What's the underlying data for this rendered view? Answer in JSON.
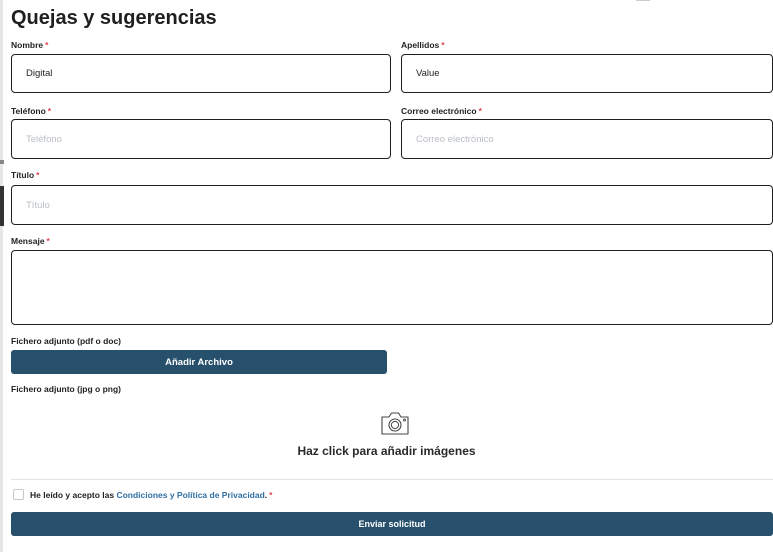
{
  "form": {
    "title": "Quejas y sugerencias",
    "required_mark": "*",
    "nombre": {
      "label": "Nombre",
      "value": "Digital"
    },
    "apellidos": {
      "label": "Apellidos",
      "value": "Value"
    },
    "telefono": {
      "label": "Teléfono",
      "placeholder": "Teléfono"
    },
    "correo": {
      "label": "Correo electrónico",
      "placeholder": "Correo electrónico"
    },
    "titulo": {
      "label": "Título",
      "placeholder": "Título"
    },
    "mensaje": {
      "label": "Mensaje"
    },
    "adjunto_doc": {
      "label": "Fichero adjunto (pdf o doc)",
      "button_label": "Añadir Archivo"
    },
    "adjunto_img": {
      "label": "Fichero adjunto (jpg o png)",
      "drop_text": "Haz click para añadir imágenes",
      "icon": "camera-icon"
    },
    "consent": {
      "prefix": "He leído y acepto las",
      "link": "Condiciones y Política de Privacidad",
      "suffix": "."
    },
    "submit_label": "Enviar solicitud"
  },
  "colors": {
    "button": "#27506d",
    "link": "#2f6fa3",
    "required": "#e0414a"
  }
}
